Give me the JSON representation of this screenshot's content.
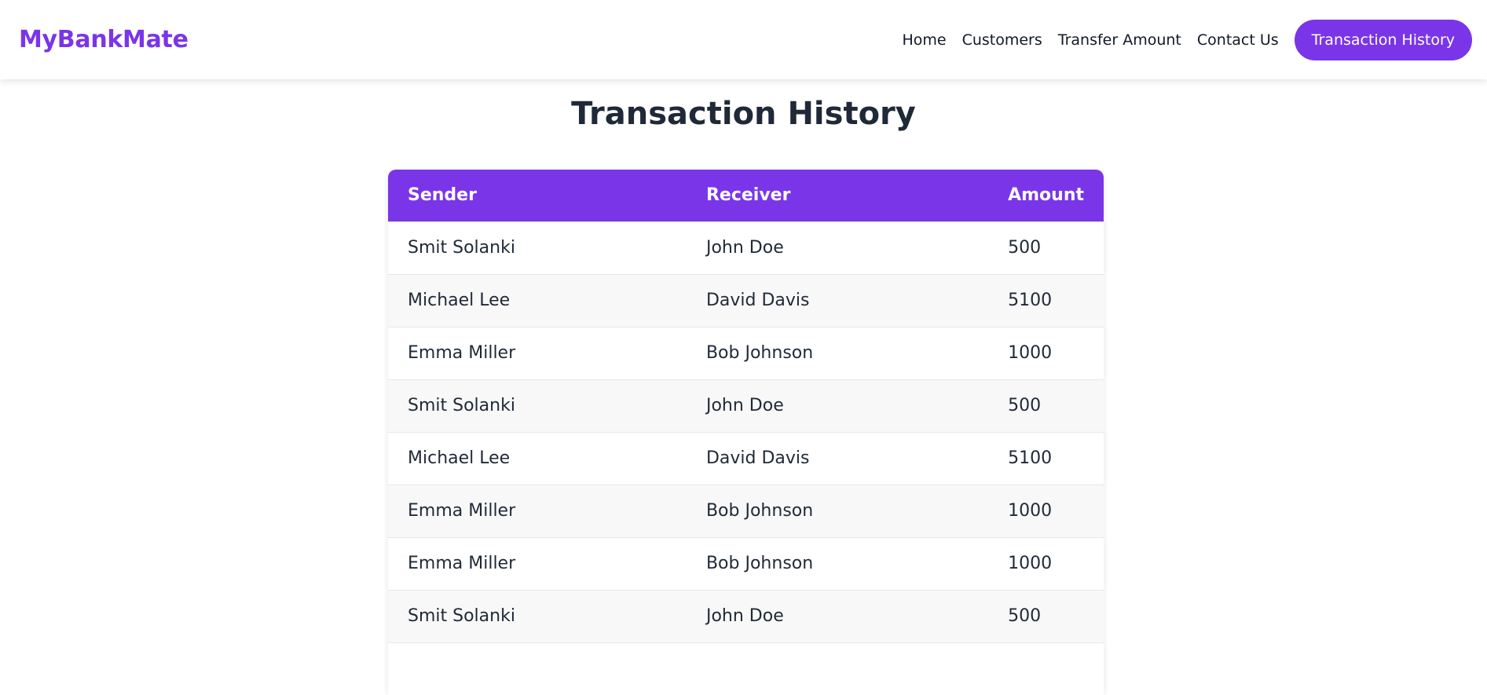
{
  "nav": {
    "brand": "MyBankMate",
    "links": [
      "Home",
      "Customers",
      "Transfer Amount",
      "Contact Us"
    ],
    "cta": "Transaction History"
  },
  "page": {
    "title": "Transaction History"
  },
  "table": {
    "headers": [
      "Sender",
      "Receiver",
      "Amount"
    ],
    "rows": [
      [
        "Smit Solanki",
        "John Doe",
        "500"
      ],
      [
        "Michael Lee",
        "David Davis",
        "5100"
      ],
      [
        "Emma Miller",
        "Bob Johnson",
        "1000"
      ],
      [
        "Smit Solanki",
        "John Doe",
        "500"
      ],
      [
        "Michael Lee",
        "David Davis",
        "5100"
      ],
      [
        "Emma Miller",
        "Bob Johnson",
        "1000"
      ],
      [
        "Emma Miller",
        "Bob Johnson",
        "1000"
      ],
      [
        "Smit Solanki",
        "John Doe",
        "500"
      ],
      [
        "",
        "",
        ""
      ]
    ]
  },
  "colors": {
    "accent": "#7a35e8"
  }
}
